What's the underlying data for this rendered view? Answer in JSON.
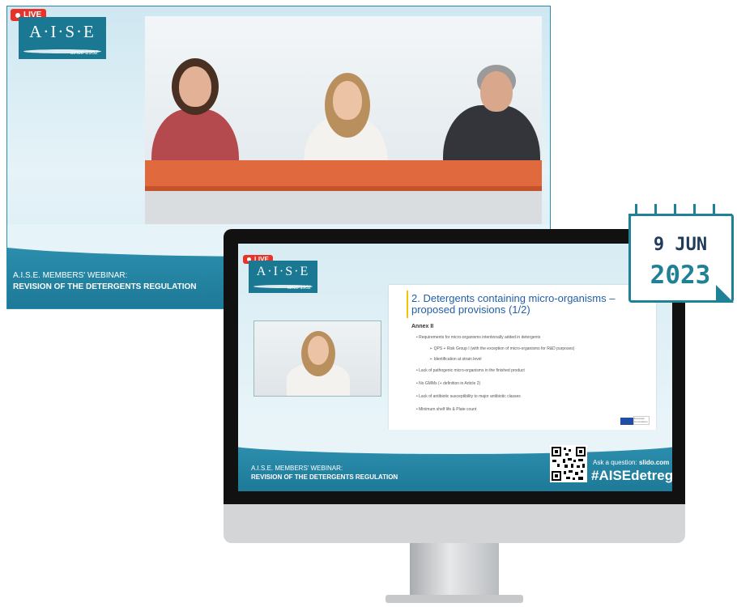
{
  "back_panel": {
    "live_badge": "LIVE",
    "logo": {
      "name": "A·I·S·E",
      "since": "since 1952"
    },
    "banner_line1": "A.I.S.E. MEMBERS' WEBINAR:",
    "banner_line2": "REVISION OF THE DETERGENTS REGULATION"
  },
  "screen": {
    "live_badge": "LIVE",
    "logo": {
      "name": "A·I·S·E",
      "since": "since 1952"
    },
    "slide": {
      "title": "2. Detergents containing micro-organisms – proposed provisions (1/2)",
      "subtitle": "Annex II",
      "bullets": [
        "• Requirements for micro-organisms intentionally added in detergents",
        "➢ QPS + Risk Group I (with the exception of micro-organisms for R&D purposes)",
        "➢ Identification at strain level",
        "• Lack of pathogenic micro-organisms in the finished product",
        "• No GMMs (+ definition in Article 2)",
        "• Lack of antibiotic susceptibility to major antibiotic classes",
        "• Minimum shelf life & Plate count"
      ],
      "footer_logo_text": "European Commission"
    },
    "banner_line1": "A.I.S.E. MEMBERS' WEBINAR:",
    "banner_line2": "REVISION OF THE DETERGENTS REGULATION",
    "ask_prefix": "Ask a question:",
    "ask_site": "slido.com",
    "hashtag": "#AISEdetreg"
  },
  "calendar": {
    "day_month": "9 JUN",
    "year": "2023"
  },
  "colors": {
    "teal": "#1f8196",
    "live_red": "#e8332a",
    "slide_blue": "#2360a8"
  }
}
